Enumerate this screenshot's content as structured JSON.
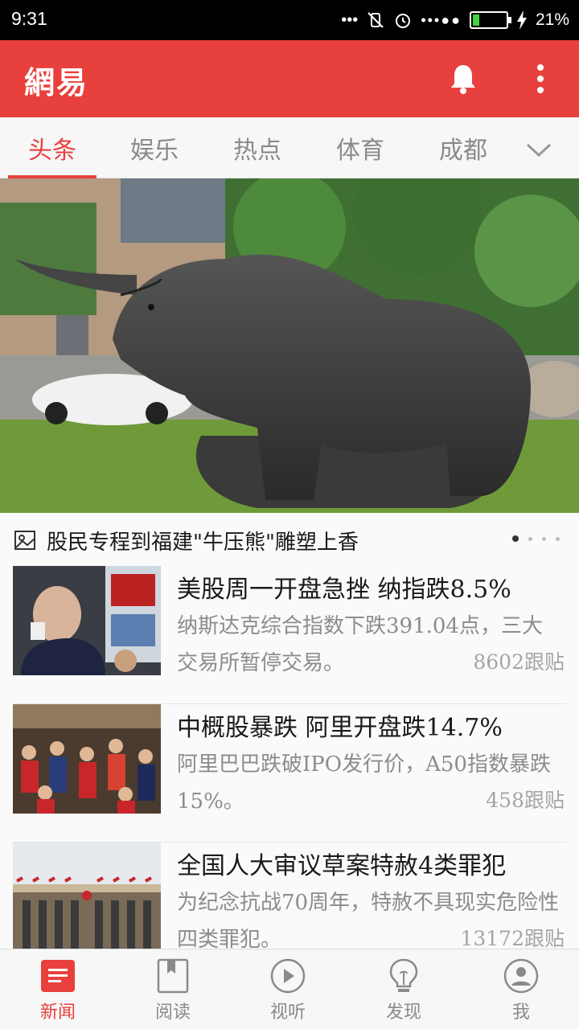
{
  "status_bar": {
    "time": "9:31",
    "dots": "•••●●",
    "battery_level": 0.21,
    "battery_pct": "21%"
  },
  "app_bar": {
    "logo": "網易",
    "icons": [
      "bell-icon",
      "more-vertical-icon"
    ]
  },
  "tabs": [
    {
      "label": "头条",
      "active": true
    },
    {
      "label": "娱乐"
    },
    {
      "label": "热点"
    },
    {
      "label": "体育"
    },
    {
      "label": "成都"
    }
  ],
  "hero": {
    "caption": "股民专程到福建\"牛压熊\"雕塑上香",
    "slide_count": 4,
    "active_slide": 1
  },
  "news": [
    {
      "title": "美股周一开盘急挫 纳指跌8.5%",
      "summary": "纳斯达克综合指数下跌391.04点，三大交易所暂停交易。",
      "comments": "8602跟贴"
    },
    {
      "title": "中概股暴跌 阿里开盘跌14.7%",
      "summary": "阿里巴巴跌破IPO发行价，A50指数暴跌15%。",
      "comments": "458跟贴"
    },
    {
      "title": "全国人大审议草案特赦4类罪犯",
      "summary": "为纪念抗战70周年，特赦不具现实危险性四类罪犯。",
      "comments": "13172跟贴"
    }
  ],
  "bottom_nav": [
    {
      "label": "新闻",
      "icon": "news-icon",
      "active": true
    },
    {
      "label": "阅读",
      "icon": "bookmark-icon"
    },
    {
      "label": "视听",
      "icon": "play-icon"
    },
    {
      "label": "发现",
      "icon": "lightbulb-icon"
    },
    {
      "label": "我",
      "icon": "user-icon"
    }
  ],
  "colors": {
    "brand_red": "#e8403d",
    "text_dark": "#1a1a1a",
    "text_gray": "#8c8c8c"
  }
}
